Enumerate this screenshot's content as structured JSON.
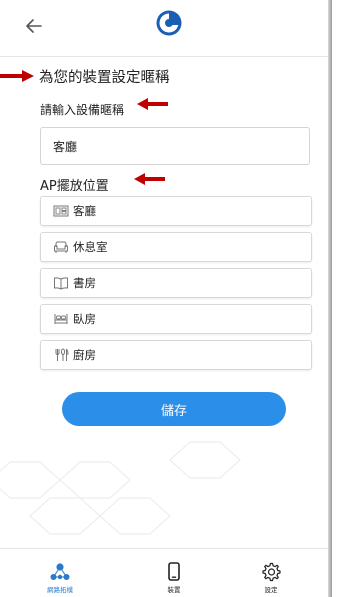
{
  "header": {
    "back_icon": "arrow-left-icon",
    "logo_icon": "chunghwa-logo-icon"
  },
  "form": {
    "title": "為您的裝置設定暱稱",
    "subtitle": "請輸入設備暱稱",
    "name_value": "客廳",
    "ap_label": "AP擺放位置"
  },
  "locations": [
    {
      "label": "客廳",
      "icon": "living-room-icon"
    },
    {
      "label": "休息室",
      "icon": "sofa-icon"
    },
    {
      "label": "書房",
      "icon": "book-icon"
    },
    {
      "label": "臥房",
      "icon": "bed-icon"
    },
    {
      "label": "廚房",
      "icon": "kitchen-utensils-icon"
    }
  ],
  "save_label": "儲存",
  "tabbar": {
    "items": [
      {
        "label": "網路拓樸",
        "icon": "network-topology-icon",
        "active": true
      },
      {
        "label": "裝置",
        "icon": "phone-icon",
        "active": false
      },
      {
        "label": "設定",
        "icon": "gear-icon",
        "active": false
      }
    ]
  },
  "colors": {
    "accent": "#2b8ee8",
    "annotation_arrow": "#c00000",
    "active_tab": "#2b79c9"
  }
}
